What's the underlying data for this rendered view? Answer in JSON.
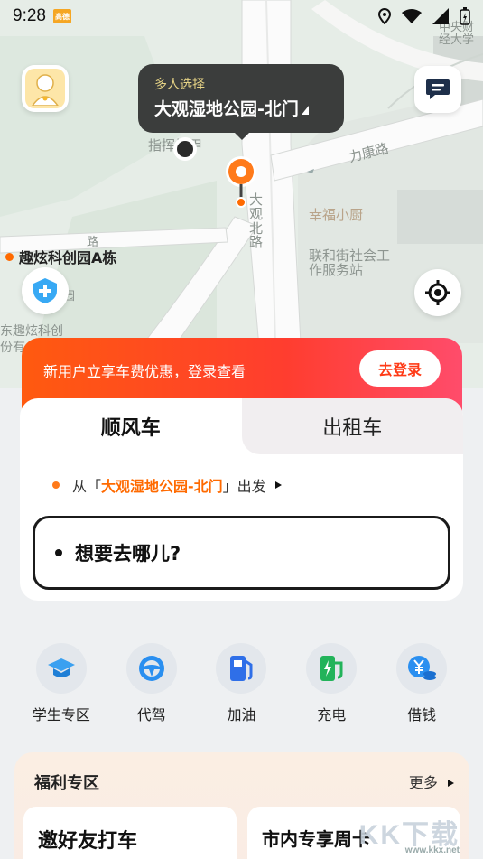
{
  "status": {
    "time": "9:28",
    "app_badge": "高德"
  },
  "map": {
    "labels": {
      "road_likang": "力康路",
      "road_daguan_north": "大观北路",
      "poi_xingfu": "幸福小厨",
      "poi_lianhe": "联和街社会工作服务站",
      "poi_zhihuilou": "指挥楼甲",
      "poi_zhongyang": "中央财经大学",
      "poi_dongqu": "东趣炫科创",
      "poi_fen": "份有",
      "poi_road_small": "路",
      "poi_yuan": "园"
    },
    "place_marker": "趣炫科创园A栋"
  },
  "pickup_tooltip": {
    "subtitle": "多人选择",
    "title": "大观湿地公园-北门"
  },
  "promo": {
    "text": "新用户立享车费优惠，登录查看",
    "login_button": "去登录"
  },
  "tabs": [
    {
      "label": "顺风车"
    },
    {
      "label": "出租车"
    }
  ],
  "from": {
    "prefix": "从「",
    "place": "大观湿地公园-北门",
    "suffix": "」出发"
  },
  "destination": {
    "placeholder": "想要去哪儿?"
  },
  "services": [
    {
      "label": "学生专区",
      "icon": "graduation-cap-icon"
    },
    {
      "label": "代驾",
      "icon": "steering-wheel-icon"
    },
    {
      "label": "加油",
      "icon": "fuel-pump-icon"
    },
    {
      "label": "充电",
      "icon": "charging-station-icon"
    },
    {
      "label": "借钱",
      "icon": "yuan-coin-icon"
    }
  ],
  "welfare": {
    "title": "福利专区",
    "more": "更多",
    "cards": [
      {
        "label": "邀好友打车"
      },
      {
        "label": "市内专享周卡"
      }
    ]
  },
  "watermark": {
    "text": "KK下载",
    "url": "www.kkx.net"
  },
  "colors": {
    "accent": "#ff5a0f",
    "tooltip_bg": "#3b3d3c",
    "service_icon_bg": "#e3e7ec"
  }
}
